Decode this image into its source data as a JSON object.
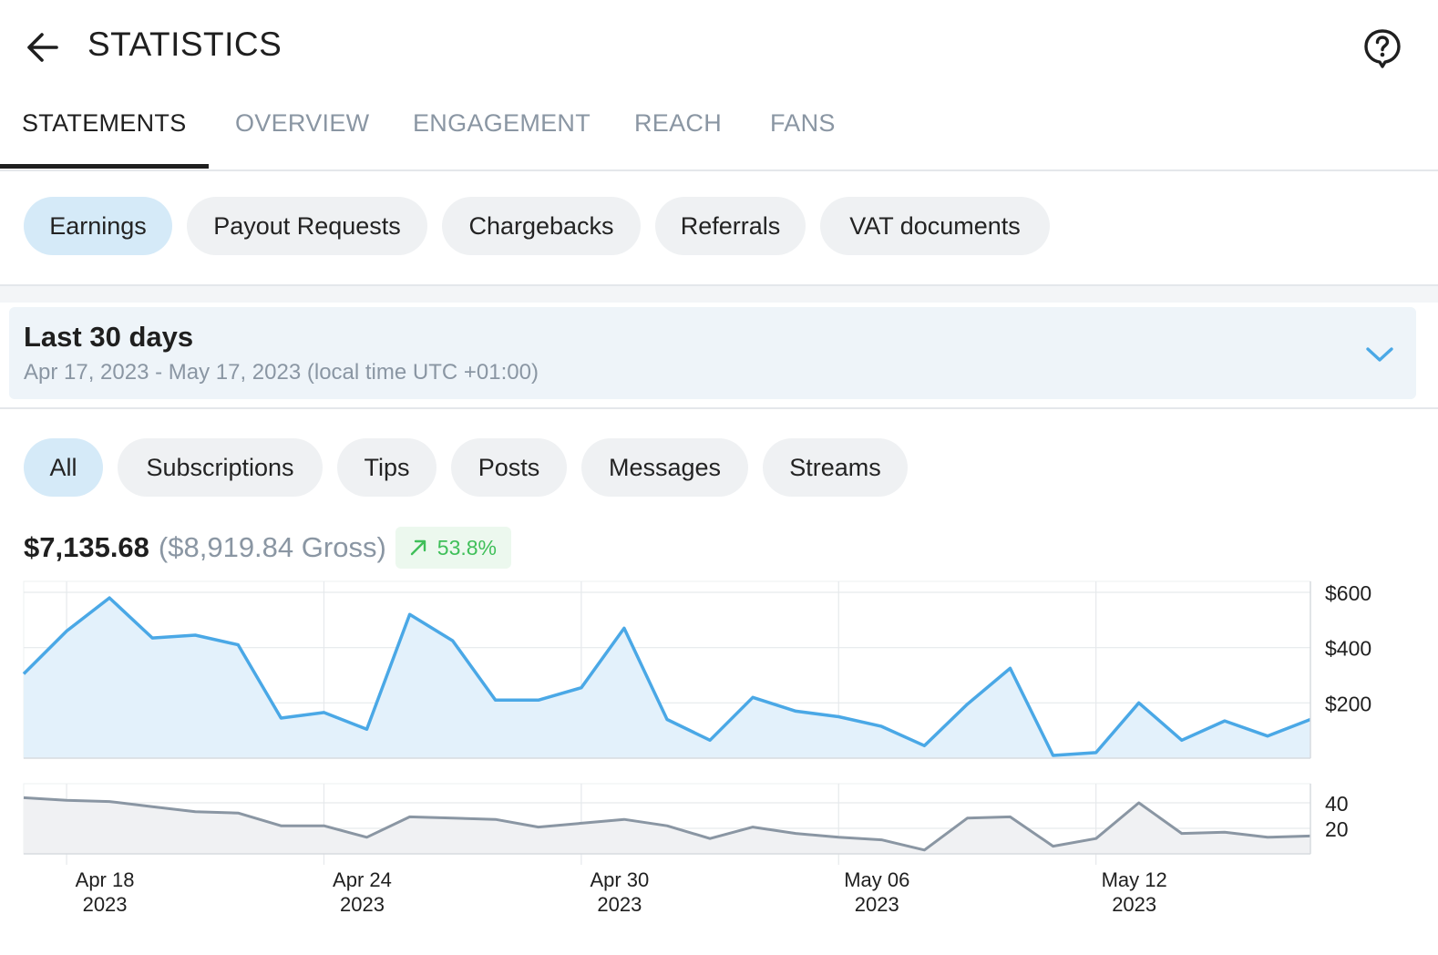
{
  "header": {
    "title": "STATISTICS",
    "back_icon": "arrow-left-icon",
    "help_icon": "help-circle-icon"
  },
  "tabs": [
    {
      "label": "STATEMENTS",
      "active": true
    },
    {
      "label": "OVERVIEW",
      "active": false
    },
    {
      "label": "ENGAGEMENT",
      "active": false
    },
    {
      "label": "REACH",
      "active": false
    },
    {
      "label": "FANS",
      "active": false
    }
  ],
  "statement_chips": [
    {
      "label": "Earnings",
      "active": true
    },
    {
      "label": "Payout Requests",
      "active": false
    },
    {
      "label": "Chargebacks",
      "active": false
    },
    {
      "label": "Referrals",
      "active": false
    },
    {
      "label": "VAT documents",
      "active": false
    }
  ],
  "date_range": {
    "title": "Last 30 days",
    "subtitle": "Apr 17, 2023 - May 17, 2023 (local time UTC +01:00)",
    "icon": "chevron-down-icon"
  },
  "earning_chips": [
    {
      "label": "All",
      "active": true
    },
    {
      "label": "Subscriptions",
      "active": false
    },
    {
      "label": "Tips",
      "active": false
    },
    {
      "label": "Posts",
      "active": false
    },
    {
      "label": "Messages",
      "active": false
    },
    {
      "label": "Streams",
      "active": false
    }
  ],
  "summary": {
    "net": "$7,135.68",
    "gross": "($8,919.84 Gross)",
    "change": "53.8%",
    "change_icon": "arrow-up-right-icon"
  },
  "colors": {
    "accent": "#4aa8e6",
    "positive": "#3fbf59",
    "muted": "#8a96a3",
    "chip_active": "#d5eaf8"
  },
  "chart_data": [
    {
      "type": "area",
      "x": [
        "2023-04-17",
        "2023-04-18",
        "2023-04-19",
        "2023-04-20",
        "2023-04-21",
        "2023-04-22",
        "2023-04-23",
        "2023-04-24",
        "2023-04-25",
        "2023-04-26",
        "2023-04-27",
        "2023-04-28",
        "2023-04-29",
        "2023-04-30",
        "2023-05-01",
        "2023-05-02",
        "2023-05-03",
        "2023-05-04",
        "2023-05-05",
        "2023-05-06",
        "2023-05-07",
        "2023-05-08",
        "2023-05-09",
        "2023-05-10",
        "2023-05-11",
        "2023-05-12",
        "2023-05-13",
        "2023-05-14",
        "2023-05-15",
        "2023-05-16",
        "2023-05-17"
      ],
      "series": [
        {
          "values": [
            305,
            460,
            580,
            435,
            445,
            410,
            145,
            165,
            105,
            520,
            425,
            210,
            210,
            255,
            470,
            140,
            65,
            220,
            170,
            150,
            115,
            45,
            195,
            325,
            10,
            20,
            200,
            65,
            135,
            80,
            140
          ]
        }
      ],
      "ylim": [
        0,
        600
      ],
      "yticks": [
        200,
        400,
        600
      ],
      "ytick_labels": [
        "$200",
        "$400",
        "$600"
      ],
      "xlabel": "",
      "ylabel": "",
      "grid": true
    },
    {
      "type": "area",
      "x_ref": "same as above",
      "series": [
        {
          "values": [
            44,
            42,
            41,
            37,
            33,
            32,
            22,
            22,
            13,
            29,
            28,
            27,
            21,
            24,
            27,
            22,
            12,
            21,
            16,
            13,
            11,
            3,
            28,
            29,
            6,
            12,
            40,
            16,
            17,
            13,
            14
          ]
        }
      ],
      "ylim": [
        0,
        55
      ],
      "yticks": [
        20,
        40
      ],
      "ytick_labels": [
        "20",
        "40"
      ],
      "xticks": [
        "2023-04-18",
        "2023-04-24",
        "2023-04-30",
        "2023-05-06",
        "2023-05-12"
      ],
      "xtick_labels": [
        [
          "Apr 18",
          "2023"
        ],
        [
          "Apr 24",
          "2023"
        ],
        [
          "Apr 30",
          "2023"
        ],
        [
          "May 06",
          "2023"
        ],
        [
          "May 12",
          "2023"
        ]
      ],
      "grid": true
    }
  ]
}
